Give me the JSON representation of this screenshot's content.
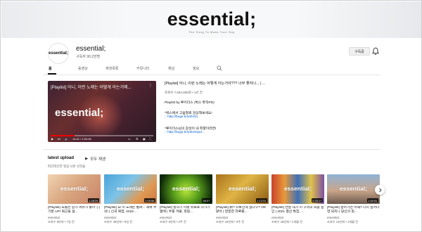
{
  "banner": {
    "title": "essential;",
    "subtitle": "The Song To Make Your Day"
  },
  "channel": {
    "avatar_text": "essential;",
    "name": "essential;",
    "subscribers": "구독자 90.2만명",
    "subscribe_label": "구독중"
  },
  "tabs": [
    {
      "label": "홈",
      "active": true
    },
    {
      "label": "동영상"
    },
    {
      "label": "재생목록"
    },
    {
      "label": "커뮤니티"
    },
    {
      "label": "채널"
    },
    {
      "label": "정보"
    }
  ],
  "featured": {
    "player_title": "[Playlist] 아니, 이런 노래는 어떻게 아는거에...",
    "player_logo": "essential;",
    "time": "14:41 / 1:04:46",
    "progress_fraction": 0.23,
    "title": "[Playlist] 아니, 이런 노래는 어떻게 아는거야??? 너무 좋자나... | ...",
    "meta": "조회수 7,594,059회 • 1년 전",
    "lines": [
      {
        "text": "Playlist by 루이더스 (벅스 뮤직PD)",
        "link": false
      },
      {
        "text": "*벅스에서 고음질로 감상해보세요!",
        "link": false
      },
      {
        "text": ":: http://bugs.kr/yt0191",
        "link": true
      },
      {
        "text": "*루이더스님의 감성이 내 취향이라면!",
        "link": false
      },
      {
        "text": ":: http://bugs.kr/yt0191pd...",
        "link": true
      }
    ]
  },
  "shelf": {
    "title": "latest upload",
    "play_all": "모두 재생",
    "description": "따끈따끈한 영상 나온 신작들",
    "cards": [
      {
        "title": "[Playlist] 오늘은 뭔가 여유가 좋아 :) | 기분 UP! 퇴근을 설...",
        "channel": "essential;",
        "meta": "조회수 8만회 • 7일 전",
        "duration": "1:28:29",
        "thumb": "warm"
      },
      {
        "title": "[Playlist] 日 이 노래는 벌써... 새벽 주의! | 신곡 북컵, 2022...",
        "channel": "essential;",
        "meta": "조회수 29만회 • 9일 전",
        "duration": "1:09:56",
        "thumb": "sky"
      },
      {
        "title": "[Playlist] 칼하기 이렇 위로로 나가기 열애 | 주중 겨울, 힐링...",
        "channel": "essential;",
        "meta": "조회수 9만회 • 2주 전",
        "duration": "56:37",
        "thumb": "green"
      },
      {
        "title": "[Playlist] 新? 지루한게 싫다구? OK 맡아 | 찐찐한 하루를...",
        "channel": "essential;",
        "meta": "조회수 24만회 • 3주 전",
        "duration": "1:12:31",
        "thumb": "gold"
      },
      {
        "title": "[Playlist] 연말 내가 이 구역의 최종 일인 | 2021 결산 특집, ...",
        "channel": "essential;",
        "meta": "조회수 18만회 • 1개월 전",
        "duration": "2:33:17",
        "thumb": "mix"
      },
      {
        "title": "[Playlist] 날아가면 어때? 다시 일어나면 되지! | 당신의 힐...",
        "channel": "essential;",
        "meta": "조회수 14만회 • 1개월 전",
        "duration": "1:52:51",
        "thumb": "dusk"
      }
    ]
  }
}
